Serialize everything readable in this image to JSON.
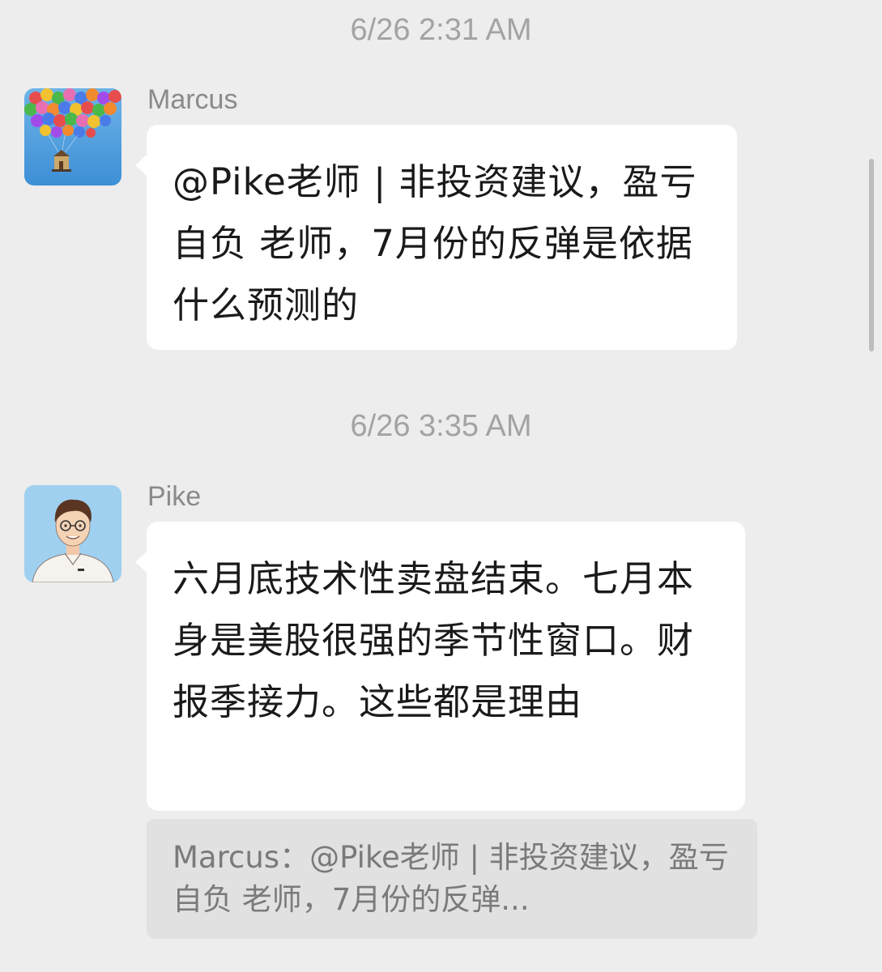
{
  "messages": [
    {
      "timestamp": "6/26 2:31 AM",
      "sender": "Marcus",
      "text": "@Pike老师 | 非投资建议，盈亏自负 老师，7月份的反弹是依据什么预测的"
    },
    {
      "timestamp": "6/26 3:35 AM",
      "sender": "Pike",
      "text": "六月底技术性卖盘结束。七月本身是美股很强的季节性窗口。财报季接力。这些都是理由"
    }
  ],
  "quote": {
    "text": "Marcus：@Pike老师 | 非投资建议，盈亏自负 老师，7月份的反弹..."
  },
  "colors": {
    "background": "#ededed",
    "bubble": "#ffffff",
    "quote_bg": "#e1e1e1",
    "timestamp": "#a3a3a3",
    "sender": "#8a8a8a"
  },
  "icons": {
    "marcus_avatar": "balloon-house-avatar",
    "pike_avatar": "cartoon-man-avatar"
  }
}
